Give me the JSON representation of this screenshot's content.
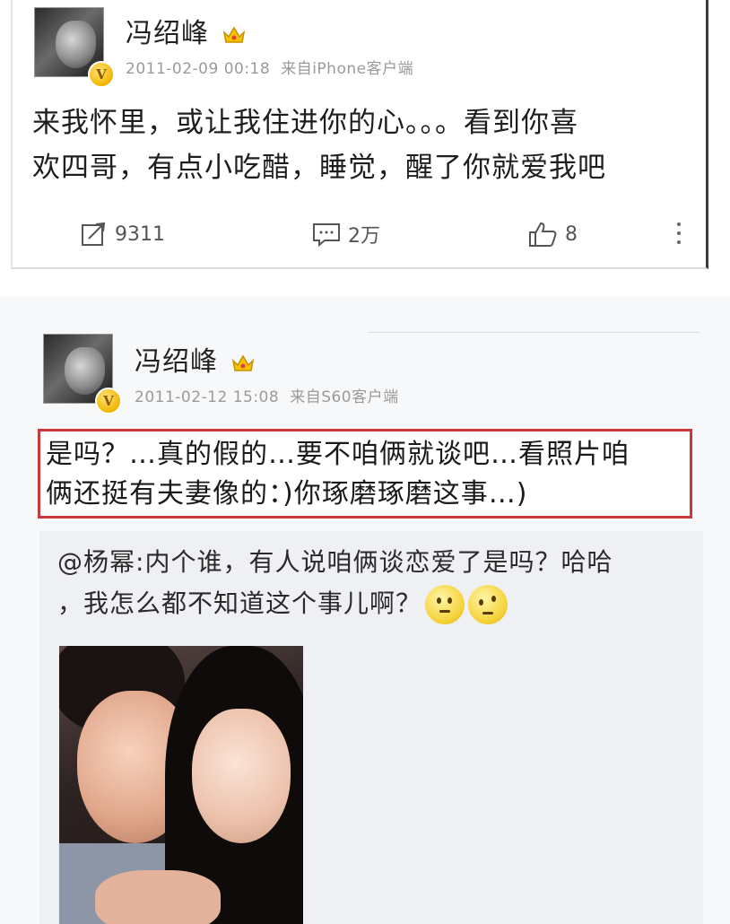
{
  "post1": {
    "username": "冯绍峰",
    "timestamp": "2011-02-09 00:18",
    "source": "来自iPhone客户端",
    "text_line1": "来我怀里，或让我住进你的心。。。看到你喜",
    "text_line2": "欢四哥，有点小吃醋，睡觉，醒了你就爱我吧",
    "actions": {
      "repost_count": "9311",
      "comment_count": "2万",
      "like_count": "8"
    },
    "icons": [
      "avatar",
      "v-badge",
      "crown-icon",
      "repost-icon",
      "comment-icon",
      "like-icon",
      "more-icon"
    ]
  },
  "post2": {
    "username": "冯绍峰",
    "timestamp": "2011-02-12 15:08",
    "source": "来自S60客户端",
    "text_line1": "是吗？…真的假的…要不咱俩就谈吧…看照片咱",
    "text_line2": "俩还挺有夫妻像的：)你琢磨琢磨这事…)",
    "highlight_color": "#c9383a",
    "repost": {
      "mention": "@杨幂",
      "text_line1_rest": ":内个谁，有人说咱俩谈恋爱了是吗？哈哈",
      "text_line2": "，我怎么都不知道这个事儿啊？",
      "emojis": [
        "thinking-emoji",
        "doubt-emoji"
      ],
      "photo": "couple-photo"
    }
  },
  "colors": {
    "accent_badge": "#f2b600",
    "meta_gray": "#9a9a9a",
    "repost_bg": "#eef0f3"
  }
}
